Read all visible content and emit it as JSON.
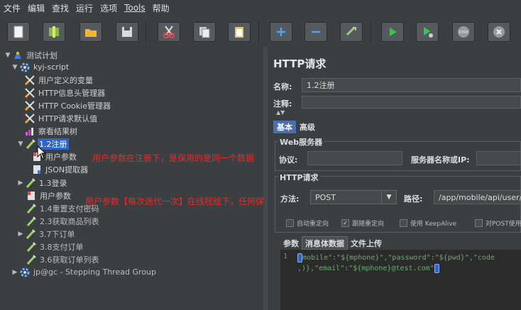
{
  "menu": [
    "文件",
    "编辑",
    "查找",
    "运行",
    "选项",
    "Tools",
    "帮助"
  ],
  "toolbar": {
    "icons": [
      "new-icon",
      "templates-icon",
      "open-icon",
      "save-icon",
      "cut-icon",
      "copy-icon",
      "paste-icon",
      "expand-icon",
      "collapse-icon",
      "toggle-icon",
      "start-icon",
      "start-no-pause-icon",
      "stop-icon",
      "shutdown-icon"
    ],
    "colors": {
      "plus": "#4aa3ff",
      "play": "#2ecc40",
      "cut": "#e24b4b"
    }
  },
  "tree": [
    {
      "label": "测试计划",
      "icon": "test-plan-icon"
    },
    {
      "label": "kyj-script",
      "icon": "thread-group-icon"
    },
    {
      "label": "用户定义的变量",
      "icon": "config-element-icon"
    },
    {
      "label": "HTTP信息头管理器",
      "icon": "config-element-icon"
    },
    {
      "label": "HTTP Cookie管理器",
      "icon": "config-element-icon"
    },
    {
      "label": "HTTP请求默认值",
      "icon": "config-element-icon"
    },
    {
      "label": "察看结果树",
      "icon": "listener-icon"
    },
    {
      "label": "1.2注册",
      "icon": "sampler-icon"
    },
    {
      "label": "用户参数",
      "icon": "preprocessor-icon"
    },
    {
      "label": "JSON提取器",
      "icon": "postprocessor-icon"
    },
    {
      "label": "1.3登录",
      "icon": "sampler-icon"
    },
    {
      "label": "用户参数",
      "icon": "preprocessor-icon"
    },
    {
      "label": "1.4重置支付密码",
      "icon": "sampler-icon"
    },
    {
      "label": "2.3获取商品列表",
      "icon": "sampler-icon"
    },
    {
      "label": "3.7下订单",
      "icon": "sampler-icon"
    },
    {
      "label": "3.8支付订单",
      "icon": "sampler-icon"
    },
    {
      "label": "3.6获取订单列表",
      "icon": "sampler-icon"
    },
    {
      "label": "jp@gc - Stepping Thread Group",
      "icon": "thread-group-icon"
    }
  ],
  "annotations": {
    "note1": "用户参数在注册下，是保用的是同一个数据",
    "note2": "用户参数【每次迭代一次】在线程组下，任何保用的是同一个数据"
  },
  "panel": {
    "title": "HTTP请求",
    "name_label": "名称:",
    "name_value": "1.2注册",
    "comment_label": "注释:",
    "tabs": [
      "基本",
      "高级"
    ],
    "web_server_label": "Web服务器",
    "protocol_label": "协议:",
    "server_label": "服务器名称或IP:",
    "http_request_label": "HTTP请求",
    "method_label": "方法:",
    "method_value": "POST",
    "path_label": "路径:",
    "path_value": "/app/mobile/api/user/r",
    "checkboxes": [
      {
        "label": "自动重定向",
        "checked": false
      },
      {
        "label": "跟随重定向",
        "checked": true
      },
      {
        "label": "使用 KeepAlive",
        "checked": false
      },
      {
        "label": "对POST使用",
        "checked": false
      }
    ],
    "body_tabs": [
      "参数",
      "消息体数据",
      "文件上传"
    ],
    "line_number": "1",
    "code_line1": "mobile\":\"${mphone}\",\"password\":\"${pwd}\",\"code",
    "code_line2": ",)},\"email\":\"${mphone}@test.com\""
  }
}
